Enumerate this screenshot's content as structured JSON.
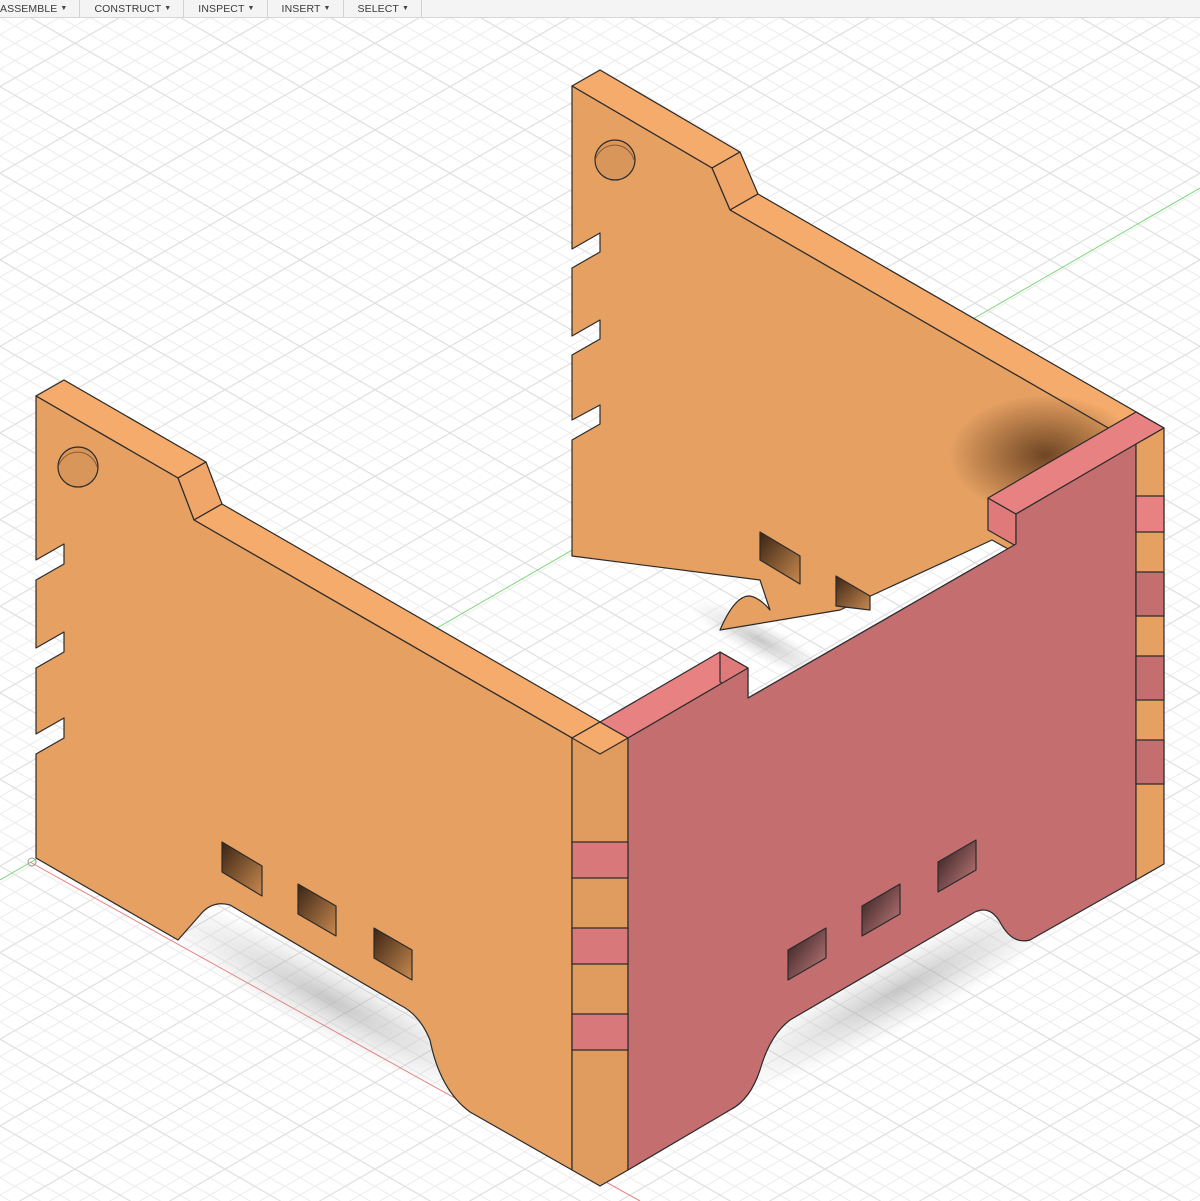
{
  "toolbar": {
    "menus": [
      {
        "label": "ASSEMBLE"
      },
      {
        "label": "CONSTRUCT"
      },
      {
        "label": "INSPECT"
      },
      {
        "label": "INSERT"
      },
      {
        "label": "SELECT"
      }
    ],
    "caret_icon": "triangle-down"
  },
  "viewport": {
    "grid": "isometric",
    "colors": {
      "background": "#ffffff",
      "grid_minor": "#ececec",
      "grid_major": "#dcdcdc",
      "panel_face": "#e5a062",
      "panel_top": "#f4ab6c",
      "panel_edge": "#d18f55",
      "selected_face": "#c46e70",
      "selected_top": "#e88282",
      "hole_dark": "#7a5030",
      "axis_x": "#e07070",
      "axis_y": "#6fd06f",
      "outline": "#2b2b2b"
    }
  }
}
